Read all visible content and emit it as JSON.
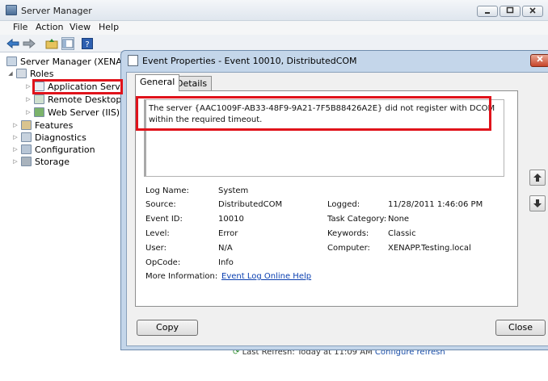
{
  "window": {
    "title": "Server Manager"
  },
  "menu": [
    "File",
    "Action",
    "View",
    "Help"
  ],
  "tree": {
    "root": "Server Manager (XENAPP)",
    "roles": "Roles",
    "application_server": "Application Server",
    "remote_desktop": "Remote Desktop Ser",
    "web_server": "Web Server (IIS)",
    "features": "Features",
    "diagnostics": "Diagnostics",
    "configuration": "Configuration",
    "storage": "Storage"
  },
  "background_status": {
    "last_refresh": "Last Refresh: Today at 11:09 AM",
    "configure": "Configure refresh"
  },
  "dialog": {
    "title": "Event Properties - Event 10010, DistributedCOM",
    "tabs": [
      "General",
      "Details"
    ],
    "description": "The server {AAC1009F-AB33-48F9-9A21-7F5B88426A2E} did not register with DCOM within the required timeout.",
    "fields": {
      "log_name_label": "Log Name:",
      "log_name": "System",
      "source_label": "Source:",
      "source": "DistributedCOM",
      "logged_label": "Logged:",
      "logged": "11/28/2011 1:46:06 PM",
      "event_id_label": "Event ID:",
      "event_id": "10010",
      "task_category_label": "Task Category:",
      "task_category": "None",
      "level_label": "Level:",
      "level": "Error",
      "keywords_label": "Keywords:",
      "keywords": "Classic",
      "user_label": "User:",
      "user": "N/A",
      "computer_label": "Computer:",
      "computer": "XENAPP.Testing.local",
      "opcode_label": "OpCode:",
      "opcode": "Info",
      "more_info_label": "More Information:",
      "more_info_link": "Event Log Online Help"
    },
    "copy_button": "Copy",
    "close_button": "Close"
  },
  "colors": {
    "highlight": "#e0131b",
    "link": "#0a3fb0",
    "dialog_frame": "#c4d6ea"
  }
}
